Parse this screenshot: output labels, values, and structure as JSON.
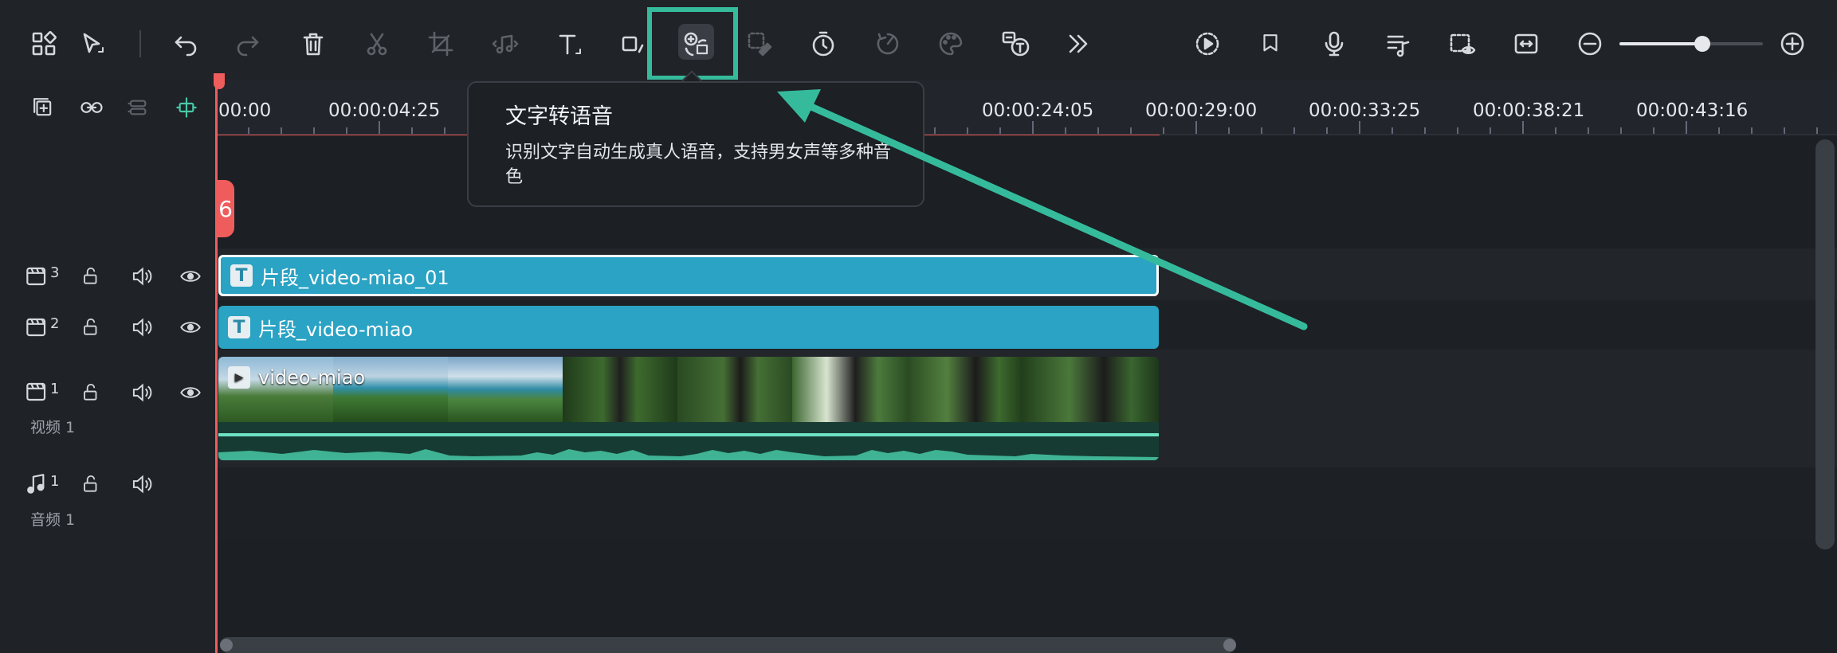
{
  "toolbar": {
    "tools": [
      "apps-grid-icon",
      "select-arrow-icon",
      "undo-icon",
      "redo-icon",
      "delete-icon",
      "cut-icon",
      "crop-icon",
      "audio-icon",
      "text-icon",
      "shape-icon",
      "text-to-speech-icon",
      "mask-icon",
      "timer-icon",
      "speed-icon",
      "color-palette-icon",
      "speech-to-text-icon",
      "more-icon",
      "render-preview-icon",
      "marker-icon",
      "microphone-icon",
      "music-list-icon",
      "preview-icon",
      "fit-icon",
      "zoom-out-icon",
      "zoom-in-icon"
    ],
    "zoom_level": 0.58
  },
  "tooltip": {
    "title": "文字转语音",
    "description": "识别文字自动生成真人语音，支持男女声等多种音色"
  },
  "ruler": {
    "timecodes": [
      "00:00",
      "00:00:04:25",
      "00:00:24:05",
      "00:00:29:00",
      "00:00:33:25",
      "00:00:38:21",
      "00:00:43:16"
    ]
  },
  "playhead": {
    "badge_text": "6"
  },
  "tracks": [
    {
      "type": "video",
      "number": "3",
      "clip_label": "片段_video-miao_01",
      "selected": true
    },
    {
      "type": "video",
      "number": "2",
      "clip_label": "片段_video-miao",
      "selected": false
    },
    {
      "type": "video",
      "number": "1",
      "clip_label": "video-miao",
      "track_name": "视频 1"
    },
    {
      "type": "audio",
      "number": "1",
      "track_name": "音频 1"
    }
  ],
  "colors": {
    "accent": "#35bb9c",
    "clip_blue": "#2aa3c4",
    "playhead": "#ef5c5c",
    "background": "#1e2126"
  }
}
